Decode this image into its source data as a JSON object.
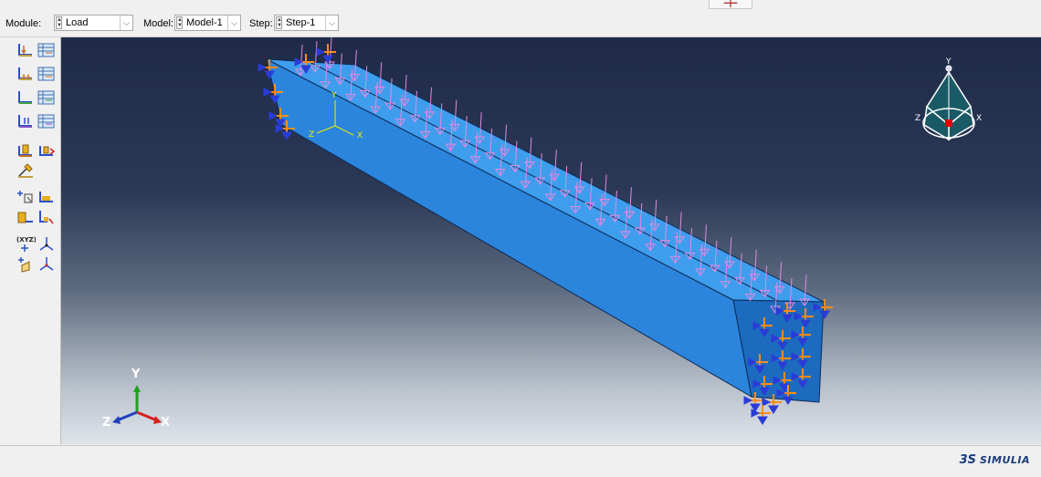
{
  "context_bar": {
    "module": {
      "label": "Module:",
      "value": "Load"
    },
    "model": {
      "label": "Model:",
      "value": "Model-1"
    },
    "step": {
      "label": "Step:",
      "value": "Step-1"
    }
  },
  "toolbox": {
    "tools": [
      {
        "icon": "create-load-icon"
      },
      {
        "icon": "load-manager-icon"
      },
      {
        "icon": "create-boundary-condition-icon"
      },
      {
        "icon": "boundary-condition-manager-icon"
      },
      {
        "icon": "create-predefined-field-icon"
      },
      {
        "icon": "predefined-field-manager-icon"
      },
      {
        "icon": "create-load-case-icon"
      },
      {
        "icon": "load-case-manager-icon"
      },
      {
        "icon": "assign-field-icon"
      },
      {
        "icon": "create-set-icon"
      },
      {
        "icon": "create-surface-icon"
      },
      {
        "icon": "partition-face-icon"
      },
      {
        "icon": "partition-cell-icon"
      },
      {
        "icon": "create-datum-point-icon"
      },
      {
        "icon": "create-datum-axis-icon"
      },
      {
        "icon": "create-datum-plane-icon"
      },
      {
        "icon": "create-datum-csys-icon"
      }
    ]
  },
  "viewport": {
    "model_colors": {
      "beam_top": "#3f9ded",
      "beam_front": "#2c85dc",
      "beam_end": "#1d6bbf",
      "edge": "#0d2a55",
      "pressure_load": "#e08ae0",
      "boundary_condition_orange": "#ff8c1a",
      "boundary_condition_blue": "#2a3cd6"
    },
    "local_csys": {
      "x": "X",
      "y": "Y",
      "z": "Z",
      "color": "#f0f000"
    },
    "triad": {
      "x": "X",
      "y": "Y",
      "z": "Z",
      "x_color": "#d62020",
      "y_color": "#1fa01f",
      "z_color": "#2040c0"
    },
    "view_cube": {
      "x": "X",
      "y": "Y",
      "z": "Z",
      "face_color": "#1a5a66",
      "marker_color": "#e00000"
    }
  },
  "status_bar": {
    "logo_mark": "3S",
    "logo_text": "SIMULIA"
  }
}
